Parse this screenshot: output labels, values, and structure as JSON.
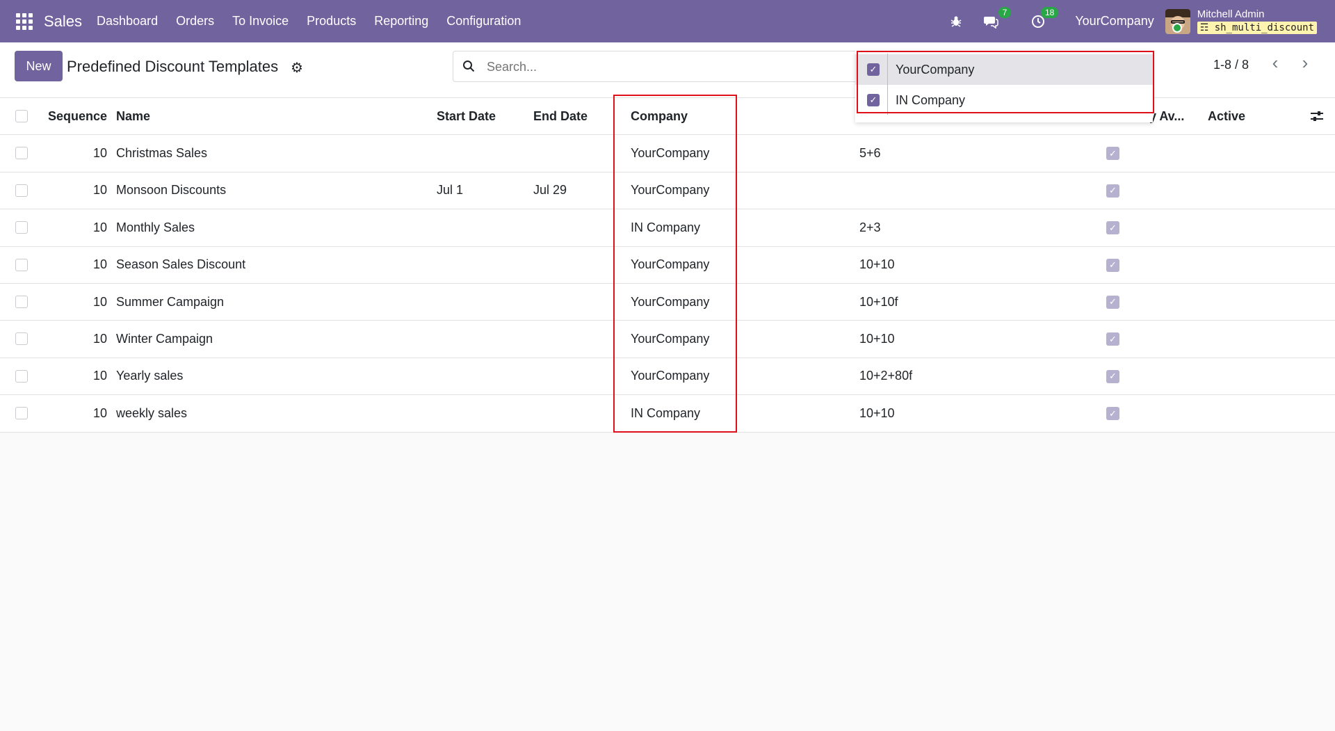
{
  "navbar": {
    "app_name": "Sales",
    "menu": [
      "Dashboard",
      "Orders",
      "To Invoice",
      "Products",
      "Reporting",
      "Configuration"
    ],
    "messages_count": "7",
    "activities_count": "18",
    "company": "YourCompany",
    "user_name": "Mitchell Admin",
    "database": "sh_multi_discount"
  },
  "control": {
    "new_label": "New",
    "title": "Predefined Discount Templates",
    "search_placeholder": "Search...",
    "pager": "1-8 / 8"
  },
  "company_switcher": {
    "items": [
      {
        "label": "YourCompany",
        "checked": true
      },
      {
        "label": "IN Company",
        "checked": true
      }
    ]
  },
  "table": {
    "headers": {
      "sequence": "Sequence",
      "name": "Name",
      "start_date": "Start Date",
      "end_date": "End Date",
      "company": "Company",
      "partial": "ly Av...",
      "active": "Active"
    },
    "rows": [
      {
        "sequence": "10",
        "name": "Christmas Sales",
        "start_date": "",
        "end_date": "",
        "company": "YourCompany",
        "discount": "5+6"
      },
      {
        "sequence": "10",
        "name": "Monsoon Discounts",
        "start_date": "Jul 1",
        "end_date": "Jul 29",
        "company": "YourCompany",
        "discount": ""
      },
      {
        "sequence": "10",
        "name": "Monthly Sales",
        "start_date": "",
        "end_date": "",
        "company": "IN Company",
        "discount": "2+3"
      },
      {
        "sequence": "10",
        "name": "Season Sales Discount",
        "start_date": "",
        "end_date": "",
        "company": "YourCompany",
        "discount": "10+10"
      },
      {
        "sequence": "10",
        "name": "Summer Campaign",
        "start_date": "",
        "end_date": "",
        "company": "YourCompany",
        "discount": "10+10f"
      },
      {
        "sequence": "10",
        "name": "Winter Campaign",
        "start_date": "",
        "end_date": "",
        "company": "YourCompany",
        "discount": "10+10"
      },
      {
        "sequence": "10",
        "name": "Yearly sales",
        "start_date": "",
        "end_date": "",
        "company": "YourCompany",
        "discount": "10+2+80f"
      },
      {
        "sequence": "10",
        "name": "weekly sales",
        "start_date": "",
        "end_date": "",
        "company": "IN Company",
        "discount": "10+10"
      }
    ]
  }
}
